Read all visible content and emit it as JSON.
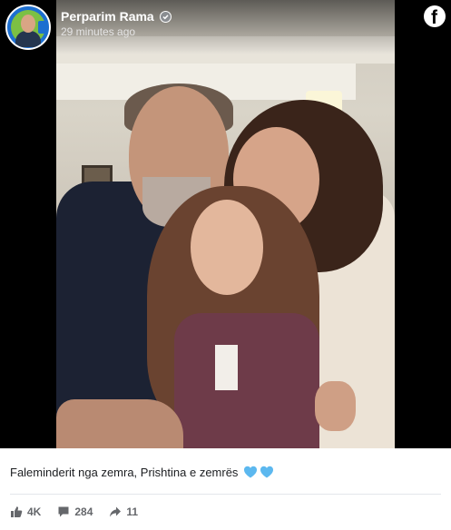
{
  "post": {
    "author": "Perparim Rama",
    "verified": true,
    "timestamp": "29 minutes ago",
    "caption": "Faleminderit nga zemra, Prishtina e zemrës",
    "caption_emoji": [
      "blue-heart",
      "blue-heart"
    ],
    "platform_icon": "facebook-logo"
  },
  "stats": {
    "likes": "4K",
    "comments": "284",
    "shares": "11"
  },
  "colors": {
    "heart": "#5cb8ef",
    "stat_text": "#65676b",
    "caption_text": "#1c1e21"
  }
}
